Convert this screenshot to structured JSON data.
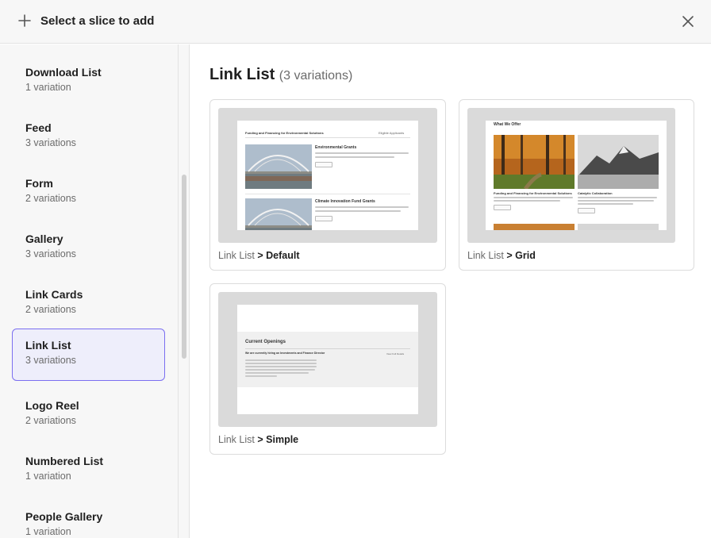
{
  "header": {
    "title": "Select a slice to add",
    "plus_icon": "plus-icon",
    "close_icon": "close-icon"
  },
  "sidebar": {
    "items": [
      {
        "name": "Download List",
        "count": "1 variation"
      },
      {
        "name": "Feed",
        "count": "3 variations"
      },
      {
        "name": "Form",
        "count": "2 variations"
      },
      {
        "name": "Gallery",
        "count": "3 variations"
      },
      {
        "name": "Link Cards",
        "count": "2 variations"
      },
      {
        "name": "Link List",
        "count": "3 variations",
        "selected": true
      },
      {
        "name": "Logo Reel",
        "count": "2 variations"
      },
      {
        "name": "Numbered List",
        "count": "1 variation"
      },
      {
        "name": "People Gallery",
        "count": "1 variation"
      }
    ],
    "selected_border_color": "#7b6ff0"
  },
  "main": {
    "title": "Link List",
    "subtitle": "(3 variations)",
    "cards": [
      {
        "slice": "Link List",
        "separator": ">",
        "variation": "Default",
        "preview": {
          "heading": "Funding and Financing for Environmental Solutions",
          "dropdown": "Eligible Applicants",
          "items": [
            {
              "title": "Environmental Grants",
              "text": "We support comprehensive environmental solutions for community and major projects that are based on values.",
              "button": "Apply Now"
            },
            {
              "title": "Climate Innovation Fund Grants",
              "text": "We support a broad range of climate-positive initiatives that address key environmental issues for Calgary and Edmonton.",
              "button": "Apply Now"
            }
          ]
        }
      },
      {
        "slice": "Link List",
        "separator": ">",
        "variation": "Grid",
        "preview": {
          "heading": "What We Offer",
          "items": [
            {
              "title": "Funding and Financing for Environmental Solutions",
              "text": "We work to ensure we are leading nonprofit organizations advancing environmental solutions.",
              "button": "Apply Now"
            },
            {
              "title": "Catalytic Collaboration",
              "text": "We convene expertise from the building, scientific, academic and public sectors to build capacity and transform energy systems toward low-carbon solutions.",
              "button": "Apply Now"
            }
          ]
        }
      },
      {
        "slice": "Link List",
        "separator": ">",
        "variation": "Simple",
        "preview": {
          "heading": "Current Openings",
          "subheading": "We are currently hiring an Investments and Finance Director",
          "dropdown": "View Full Details",
          "text": "Island is currently seeking a full-time Investments and Finance Director to join our organization and support strategic investments and ensure the financial health and sustainability of our programs across Alberta."
        }
      }
    ]
  }
}
